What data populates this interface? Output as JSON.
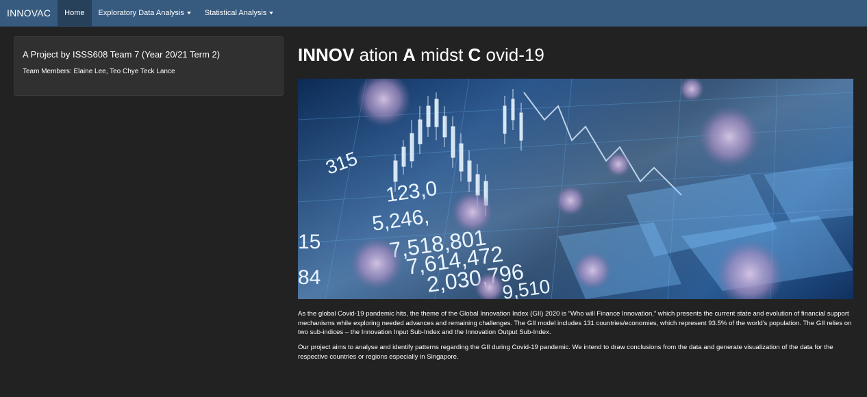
{
  "navbar": {
    "brand": "INNOVAC",
    "items": [
      {
        "label": "Home",
        "active": true,
        "dropdown": false
      },
      {
        "label": "Exploratory Data Analysis",
        "active": false,
        "dropdown": true
      },
      {
        "label": "Statistical Analysis",
        "active": false,
        "dropdown": true
      }
    ]
  },
  "sidebar": {
    "title": "A Project by ISSS608 Team 7 (Year 20/21 Term 2)",
    "members": "Team Members: Elaine Lee, Teo Chye Teck Lance"
  },
  "main": {
    "title_parts": [
      {
        "text": "INNOV",
        "bold": true
      },
      {
        "text": " ation ",
        "bold": false
      },
      {
        "text": "A",
        "bold": true
      },
      {
        "text": " midst ",
        "bold": false
      },
      {
        "text": "C",
        "bold": true
      },
      {
        "text": " ovid-19",
        "bold": false
      }
    ],
    "hero_numbers": [
      "123,0",
      "5,246,",
      "7,518,801",
      "7,614,472",
      "2,030,796",
      "9,510",
      "315",
      "15",
      "84"
    ],
    "paragraphs": [
      "As the global Covid-19 pandemic hits, the theme of the Global Innovation Index (GII) 2020 is “Who will Finance Innovation,” which presents the current state and evolution of financial support mechanisms while exploring needed advances and remaining challenges. The GII model includes 131 countries/economies, which represent 93.5% of the world’s population. The GII relies on two sub-indices – the Innovation Input Sub-Index and the Innovation Output Sub-Index.",
      "Our project aims to analyse and identify patterns regarding the GII during Covid-19 pandemic. We intend to draw conclusions from the data and generate visualization of the data for the respective countries or regions especially in Singapore."
    ]
  },
  "colors": {
    "navbar": "#375a7f",
    "navbar_active": "#28415b",
    "background": "#222222",
    "well": "#303030"
  }
}
